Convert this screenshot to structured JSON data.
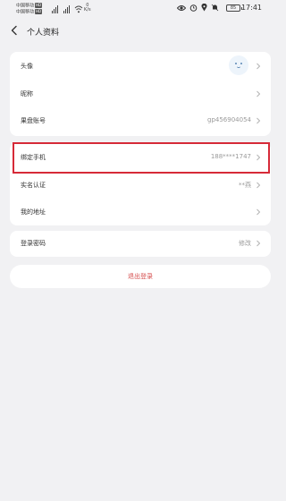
{
  "status_bar": {
    "carrier1": "中国移动",
    "carrier2": "中国移动",
    "hd": "HD",
    "net_speed_value": "0",
    "net_speed_unit": "K/s",
    "battery": "85",
    "time": "17:41"
  },
  "header": {
    "title": "个人资料"
  },
  "profile": {
    "avatar_label": "头像",
    "nickname_label": "昵称",
    "account_label": "果盘账号",
    "account_value": "gp456904054",
    "phone_label": "绑定手机",
    "phone_value": "188****1747",
    "realname_label": "实名认证",
    "realname_value": "**燕",
    "address_label": "我的地址",
    "password_label": "登录密码",
    "password_value": "修改"
  },
  "logout_label": "退出登录",
  "colors": {
    "background": "#f1f1f3",
    "highlight": "#d62a38",
    "logout_text": "#d54c4c"
  }
}
